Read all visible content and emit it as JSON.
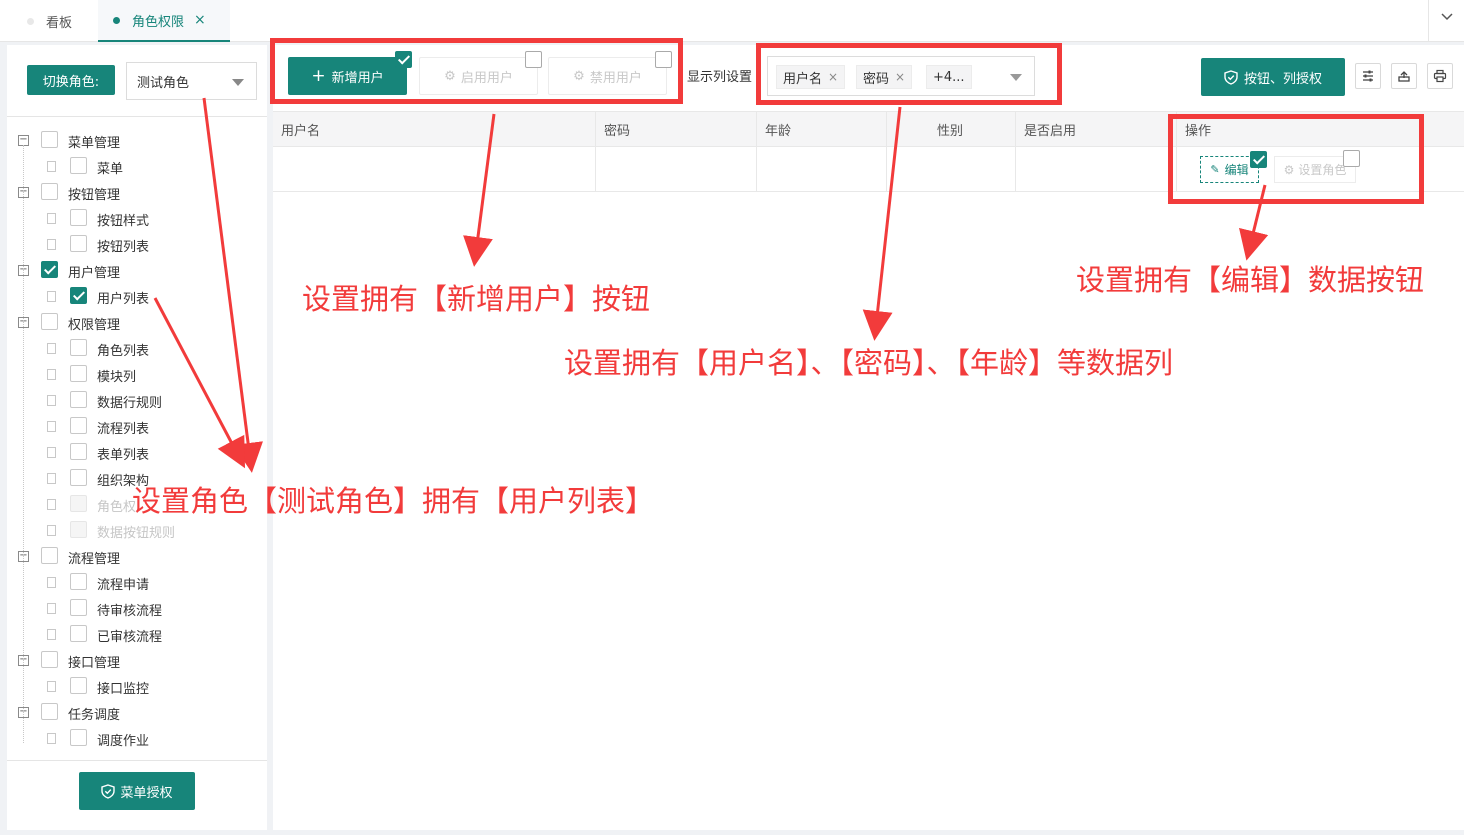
{
  "tabs": [
    {
      "label": "看板",
      "active": false
    },
    {
      "label": "角色权限",
      "active": true,
      "close": "×"
    }
  ],
  "left_panel": {
    "role_label": "切换角色:",
    "role_value": "测试角色",
    "tree": [
      {
        "label": "菜单管理",
        "level": 0,
        "checked": false,
        "disabled": false
      },
      {
        "label": "菜单",
        "level": 1,
        "checked": false,
        "disabled": false
      },
      {
        "label": "按钮管理",
        "level": 0,
        "checked": false,
        "disabled": false
      },
      {
        "label": "按钮样式",
        "level": 1,
        "checked": false,
        "disabled": false
      },
      {
        "label": "按钮列表",
        "level": 1,
        "checked": false,
        "disabled": false
      },
      {
        "label": "用户管理",
        "level": 0,
        "checked": true,
        "disabled": false
      },
      {
        "label": "用户列表",
        "level": 1,
        "checked": true,
        "disabled": false
      },
      {
        "label": "权限管理",
        "level": 0,
        "checked": false,
        "disabled": false
      },
      {
        "label": "角色列表",
        "level": 1,
        "checked": false,
        "disabled": false
      },
      {
        "label": "模块列",
        "level": 1,
        "checked": false,
        "disabled": false
      },
      {
        "label": "数据行规则",
        "level": 1,
        "checked": false,
        "disabled": false
      },
      {
        "label": "流程列表",
        "level": 1,
        "checked": false,
        "disabled": false
      },
      {
        "label": "表单列表",
        "level": 1,
        "checked": false,
        "disabled": false
      },
      {
        "label": "组织架构",
        "level": 1,
        "checked": false,
        "disabled": false
      },
      {
        "label": "角色权",
        "level": 1,
        "checked": false,
        "disabled": true
      },
      {
        "label": "数据按钮规则",
        "level": 1,
        "checked": false,
        "disabled": true
      },
      {
        "label": "流程管理",
        "level": 0,
        "checked": false,
        "disabled": false
      },
      {
        "label": "流程申请",
        "level": 1,
        "checked": false,
        "disabled": false
      },
      {
        "label": "待审核流程",
        "level": 1,
        "checked": false,
        "disabled": false
      },
      {
        "label": "已审核流程",
        "level": 1,
        "checked": false,
        "disabled": false
      },
      {
        "label": "接口管理",
        "level": 0,
        "checked": false,
        "disabled": false
      },
      {
        "label": "接口监控",
        "level": 1,
        "checked": false,
        "disabled": false
      },
      {
        "label": "任务调度",
        "level": 0,
        "checked": false,
        "disabled": false
      },
      {
        "label": "调度作业",
        "level": 1,
        "checked": false,
        "disabled": false
      }
    ],
    "menu_auth_label": "菜单授权"
  },
  "toolbar": {
    "add_user_label": "新增用户",
    "add_user_checked": true,
    "enable_user_label": "启用用户",
    "enable_user_checked": false,
    "disable_user_label": "禁用用户",
    "disable_user_checked": false,
    "column_setting_label": "显示列设置",
    "column_chips": [
      "用户名",
      "密码"
    ],
    "chip_close": "×",
    "column_more": "+4...",
    "auth_button_label": "按钮、列授权"
  },
  "table": {
    "columns": [
      "用户名",
      "密码",
      "年龄",
      "性别",
      "是否启用",
      "操作"
    ],
    "edit_label": "编辑",
    "edit_checked": true,
    "set_role_label": "设置角色",
    "set_role_checked": false
  },
  "annotations": {
    "add_user": "设置拥有【新增用户】按钮",
    "edit_btn": "设置拥有【编辑】数据按钮",
    "columns": "设置拥有【用户名】、【密码】、【年龄】等数据列",
    "role": "设置角色【测试角色】拥有【用户列表】"
  },
  "colors": {
    "primary": "#17857a",
    "annotation": "#f23b3b"
  }
}
